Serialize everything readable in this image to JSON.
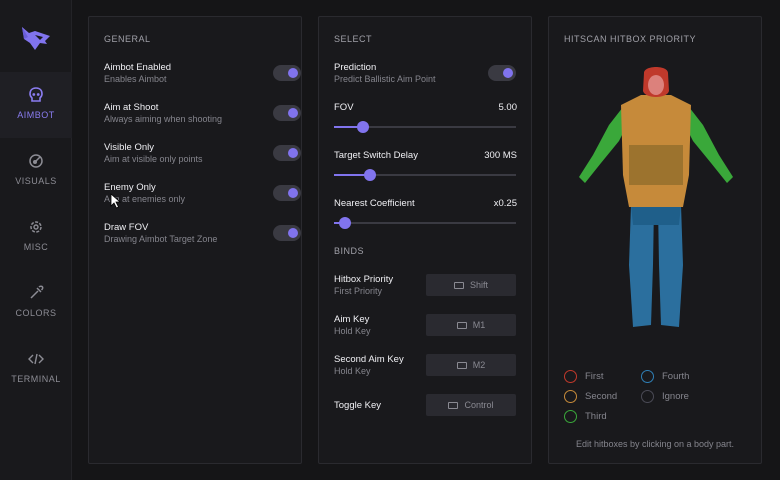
{
  "sidebar": {
    "items": [
      {
        "label": "AIMBOT",
        "icon": "skull-icon",
        "active": true
      },
      {
        "label": "VISUALS",
        "icon": "eye-icon",
        "active": false
      },
      {
        "label": "MISC",
        "icon": "gear-icon",
        "active": false
      },
      {
        "label": "COLORS",
        "icon": "eyedropper-icon",
        "active": false
      },
      {
        "label": "TERMINAL",
        "icon": "code-icon",
        "active": false
      }
    ]
  },
  "general": {
    "title": "GENERAL",
    "options": [
      {
        "title": "Aimbot Enabled",
        "subtitle": "Enables Aimbot",
        "on": true
      },
      {
        "title": "Aim at Shoot",
        "subtitle": "Always aiming when shooting",
        "on": true
      },
      {
        "title": "Visible Only",
        "subtitle": "Aim at visible only points",
        "on": true
      },
      {
        "title": "Enemy Only",
        "subtitle": "Aim at enemies only",
        "on": true
      },
      {
        "title": "Draw FOV",
        "subtitle": "Drawing Aimbot Target Zone",
        "on": true
      }
    ]
  },
  "select": {
    "title": "SELECT",
    "prediction": {
      "title": "Prediction",
      "subtitle": "Predict Ballistic Aim Point",
      "on": true
    },
    "sliders": [
      {
        "label": "FOV",
        "value": "5.00",
        "fraction": 0.16
      },
      {
        "label": "Target Switch Delay",
        "value": "300 MS",
        "fraction": 0.2
      },
      {
        "label": "Nearest Coefficient",
        "value": "x0.25",
        "fraction": 0.06
      }
    ],
    "binds_title": "BINDS",
    "binds": [
      {
        "title": "Hitbox Priority",
        "subtitle": "First Priority",
        "key": "Shift"
      },
      {
        "title": "Aim Key",
        "subtitle": "Hold Key",
        "key": "M1"
      },
      {
        "title": "Second Aim Key",
        "subtitle": "Hold Key",
        "key": "M2"
      },
      {
        "title": "Toggle Key",
        "subtitle": "",
        "key": "Control"
      }
    ]
  },
  "hitbox": {
    "title": "HITSCAN HITBOX PRIORITY",
    "legend": [
      {
        "label": "First",
        "color": "#c0392b"
      },
      {
        "label": "Second",
        "color": "#c68a3a"
      },
      {
        "label": "Third",
        "color": "#3aa83a"
      },
      {
        "label": "Fourth",
        "color": "#2f7fb5"
      },
      {
        "label": "Ignore",
        "color": "#4a4a55"
      }
    ],
    "hint": "Edit hitboxes by clicking on a body part."
  },
  "colors": {
    "accent": "#8174ee",
    "head": "#c0392b",
    "torso": "#c68a3a",
    "arms": "#3aa83a",
    "legs": "#2f7fb5"
  }
}
